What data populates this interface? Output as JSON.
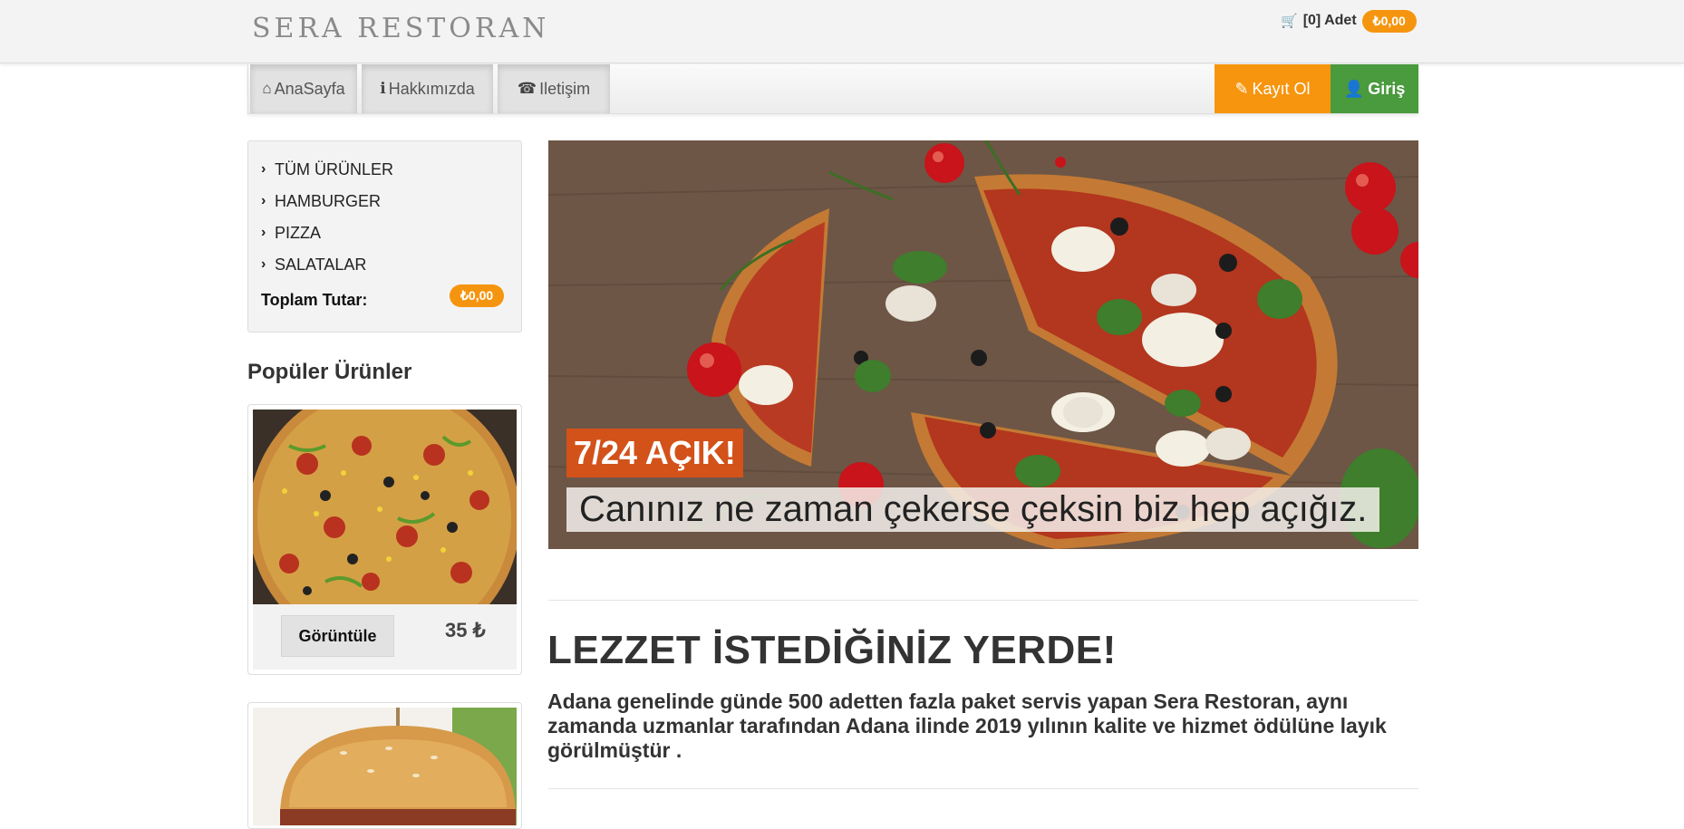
{
  "header": {
    "brand": "SERA RESTORAN",
    "cart_text": "[0] Adet",
    "cart_total": "₺0,00"
  },
  "nav": {
    "items": [
      {
        "label": "AnaSayfa",
        "icon": "home-icon"
      },
      {
        "label": "Hakkımızda",
        "icon": "info-icon"
      },
      {
        "label": "Iletişim",
        "icon": "phone-icon"
      }
    ],
    "register_label": "Kayıt Ol",
    "login_label": "Giriş"
  },
  "sidebar": {
    "categories": [
      "TÜM ÜRÜNLER",
      "HAMBURGER",
      "PIZZA",
      "SALATALAR"
    ],
    "total_label": "Toplam Tutar:",
    "total_value": "₺0,00",
    "popular_title": "Popüler Ürünler",
    "products": [
      {
        "view_label": "Görüntüle",
        "price": "35 ₺"
      },
      {
        "view_label": "",
        "price": ""
      }
    ]
  },
  "hero": {
    "badge": "7/24 AÇIK!",
    "caption": "Canınız ne zaman çekerse çeksin biz hep açığız."
  },
  "main": {
    "headline": "LEZZET İSTEDİĞİNİZ YERDE!",
    "description": "Adana genelinde günde 500 adetten fazla paket servis yapan Sera Restoran, aynı zamanda uzmanlar tarafından Adana ilinde 2019 yılının kalite ve hizmet ödülüne layık görülmüştür ."
  },
  "colors": {
    "accent_orange": "#f7950e",
    "login_green": "#4a9a3e",
    "hero_badge": "#d2521a"
  }
}
